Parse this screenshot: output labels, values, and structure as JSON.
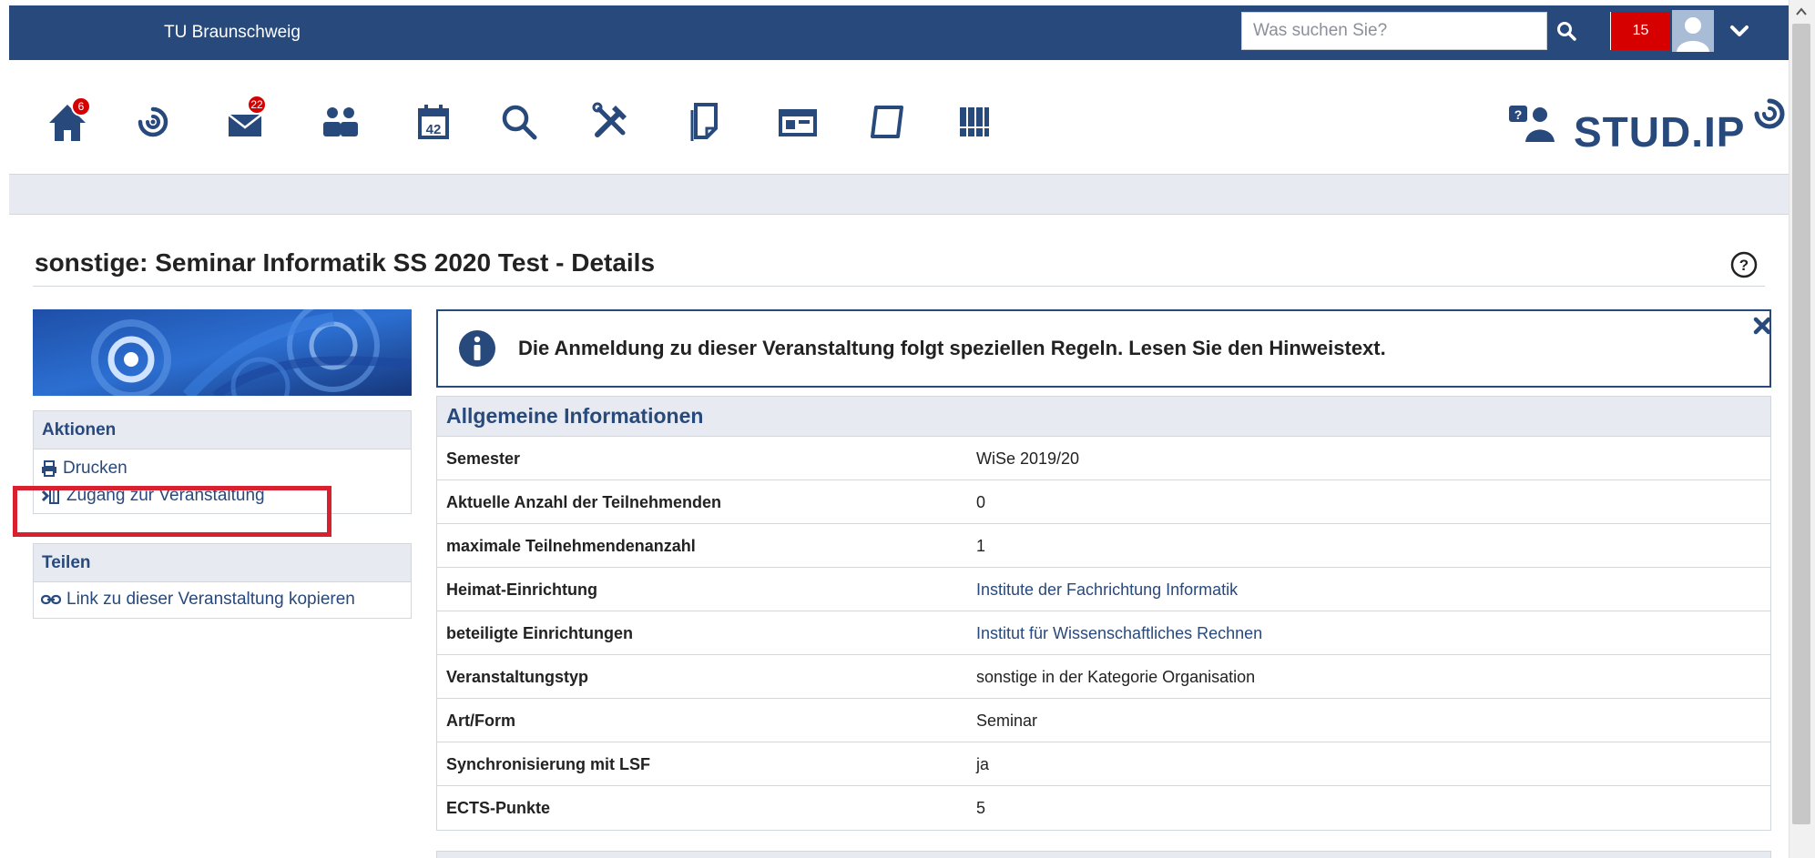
{
  "header": {
    "university": "TU Braunschweig",
    "search_placeholder": "Was suchen Sie?",
    "notifications_count": "15"
  },
  "nav": {
    "home_badge": "6",
    "messages_badge": "22",
    "calendar_day": "42"
  },
  "logo": {
    "part1": "STUD.",
    "part2": "IP"
  },
  "page": {
    "title": "sonstige: Seminar Informatik SS 2020 Test - Details"
  },
  "sidebar": {
    "actions": {
      "title": "Aktionen",
      "items": [
        "Drucken",
        "Zugang zur Veranstaltung"
      ]
    },
    "share": {
      "title": "Teilen",
      "items": [
        "Link zu dieser Veranstaltung kopieren"
      ]
    }
  },
  "message": {
    "text": "Die Anmeldung zu dieser Veranstaltung folgt speziellen Regeln. Lesen Sie den Hinweistext."
  },
  "details": {
    "title": "Allgemeine Informationen",
    "rows": [
      {
        "label": "Semester",
        "value": "WiSe 2019/20"
      },
      {
        "label": "Aktuelle Anzahl der Teilnehmenden",
        "value": "0"
      },
      {
        "label": "maximale Teilnehmendenanzahl",
        "value": "1"
      },
      {
        "label": "Heimat-Einrichtung",
        "value": "Institute der Fachrichtung Informatik"
      },
      {
        "label": "beteiligte Einrichtungen",
        "value": "Institut für Wissenschaftliches Rechnen"
      },
      {
        "label": "Veranstaltungstyp",
        "value": "sonstige in der Kategorie Organisation"
      },
      {
        "label": "Art/Form",
        "value": "Seminar"
      },
      {
        "label": "Synchronisierung mit LSF",
        "value": "ja"
      },
      {
        "label": "ECTS-Punkte",
        "value": "5"
      }
    ]
  },
  "colors": {
    "brand_blue": "#28497c",
    "alert_red": "#d60000",
    "highlight_red": "#d8202f",
    "panel_grey": "#e7ebf1"
  },
  "icons": {
    "nav": [
      "home-icon",
      "activity-icon",
      "messages-icon",
      "community-icon",
      "calendar-icon",
      "search-icon",
      "tools-icon",
      "files-icon",
      "courses-icon",
      "admin-icon",
      "library-icon"
    ],
    "other": [
      "help-people-icon",
      "info-icon",
      "close-icon",
      "print-icon",
      "door-enter-icon",
      "link-icon",
      "user-avatar-icon",
      "chevron-down-icon",
      "help-circle-icon"
    ]
  }
}
